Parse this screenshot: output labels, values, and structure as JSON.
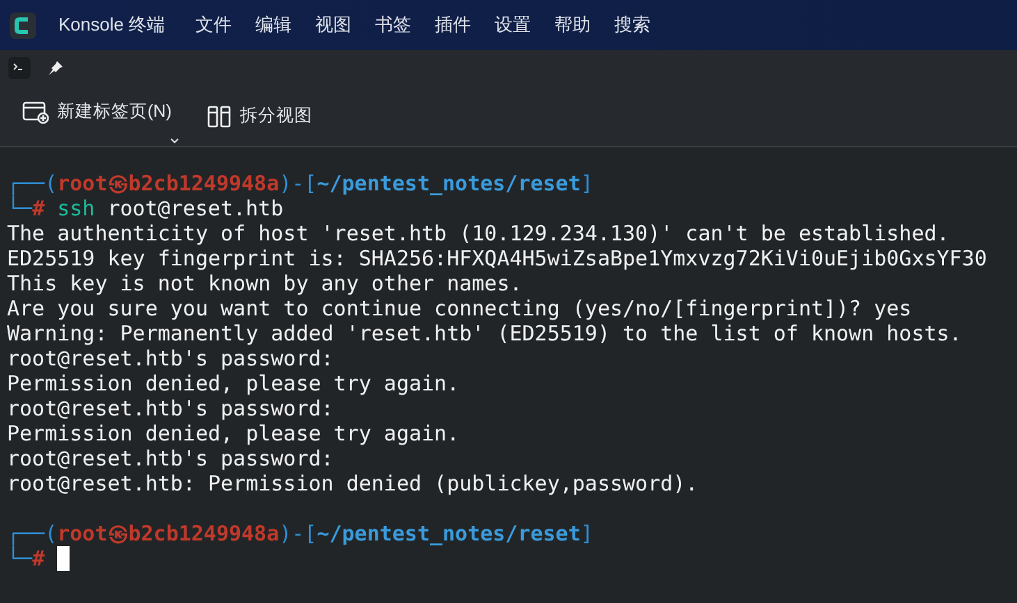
{
  "title_bar": {
    "app_title": "Konsole 终端",
    "menu": [
      "文件",
      "编辑",
      "视图",
      "书签",
      "插件",
      "设置",
      "帮助",
      "搜索"
    ]
  },
  "toolbar": {
    "buttons": [
      {
        "label": "新建标签页(N)",
        "kind": "new-tab",
        "dropdown": true
      },
      {
        "label": "拆分视图",
        "kind": "split",
        "dropdown": false
      }
    ]
  },
  "terminal": {
    "blocks": [
      {
        "kind": "prompt",
        "corner_top": "┌──(",
        "user": "root",
        "at": "㉿",
        "host": "b2cb1249948a",
        "sep": ")-[",
        "path": "~/pentest_notes/reset",
        "close": "]",
        "corner_bottom": "└─",
        "sign": "#",
        "command": "ssh",
        "args": "root@reset.htb",
        "cursor": false
      },
      {
        "kind": "output",
        "lines": [
          "The authenticity of host 'reset.htb (10.129.234.130)' can't be established.",
          "ED25519 key fingerprint is: SHA256:HFXQA4H5wiZsaBpe1Ymxvzg72KiVi0uEjib0GxsYF30",
          "This key is not known by any other names.",
          "Are you sure you want to continue connecting (yes/no/[fingerprint])? yes",
          "Warning: Permanently added 'reset.htb' (ED25519) to the list of known hosts.",
          "root@reset.htb's password:",
          "Permission denied, please try again.",
          "root@reset.htb's password:",
          "Permission denied, please try again.",
          "root@reset.htb's password:",
          "root@reset.htb: Permission denied (publickey,password)."
        ]
      },
      {
        "kind": "blank"
      },
      {
        "kind": "prompt",
        "corner_top": "┌──(",
        "user": "root",
        "at": "㉿",
        "host": "b2cb1249948a",
        "sep": ")-[",
        "path": "~/pentest_notes/reset",
        "close": "]",
        "corner_bottom": "└─",
        "sign": "#",
        "cursor": true
      }
    ]
  }
}
